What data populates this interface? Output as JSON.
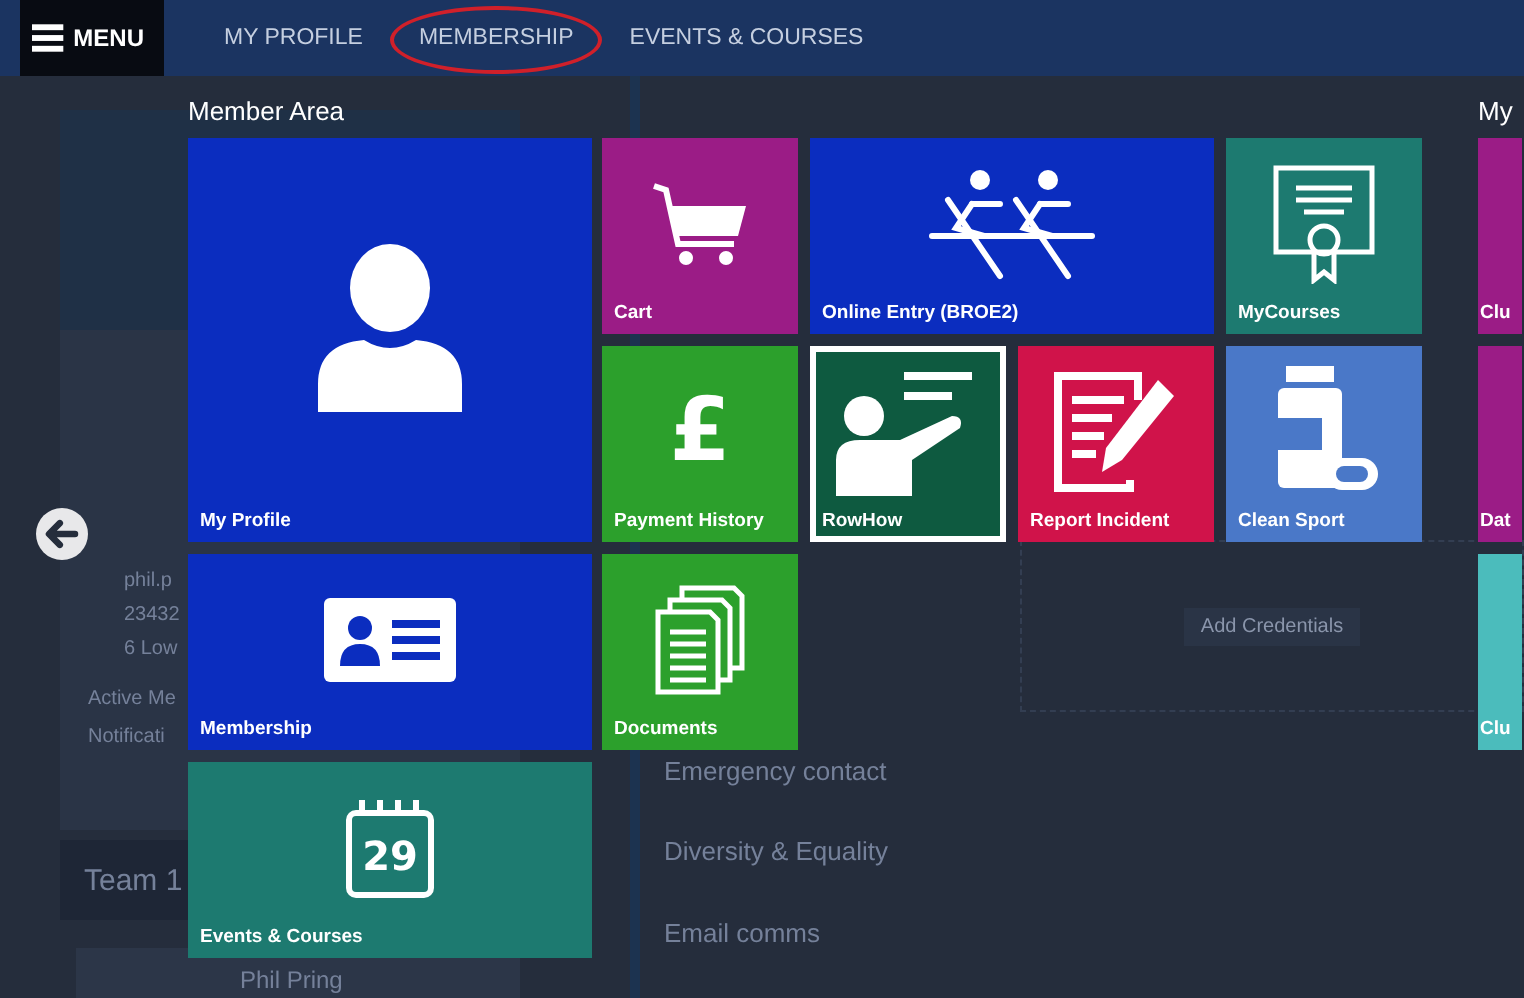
{
  "menu_button": {
    "label": "MENU"
  },
  "nav": [
    {
      "label": "MY PROFILE",
      "circled": false
    },
    {
      "label": "MEMBERSHIP",
      "circled": true
    },
    {
      "label": "EVENTS & COURSES",
      "circled": false
    }
  ],
  "background": {
    "contact_lines": [
      "phil.p",
      "23432",
      "6 Low"
    ],
    "status_lines": [
      "Active Me",
      "Notificati"
    ],
    "team_heading": "Team 1",
    "member_name": "Phil Pring",
    "settings_items": [
      "Emergency contact",
      "Diversity & Equality",
      "Email comms"
    ],
    "credentials_button": "Add Credentials"
  },
  "member_area": {
    "title": "Member Area",
    "primary_tiles": [
      {
        "label": "My Profile",
        "color": "#0b2dbf",
        "kind": "large",
        "focused": false
      },
      {
        "label": "Membership",
        "color": "#0b2dbf",
        "kind": "wide",
        "focused": false
      },
      {
        "label": "Events & Courses",
        "color": "#1d7a70",
        "kind": "wide",
        "focused": false,
        "icon_text": "29"
      }
    ],
    "tiles": [
      {
        "label": "Cart",
        "color": "#9b1c86",
        "kind": "small",
        "focused": false
      },
      {
        "label": "Online Entry (BROE2)",
        "color": "#0b2dbf",
        "kind": "wide",
        "focused": false
      },
      {
        "label": "MyCourses",
        "color": "#1d7a70",
        "kind": "small",
        "focused": false
      },
      {
        "label": "Payment History",
        "color": "#2ca02c",
        "kind": "small",
        "focused": false,
        "icon_text": "£"
      },
      {
        "label": "RowHow",
        "color": "#0e5a40",
        "kind": "small",
        "focused": true
      },
      {
        "label": "Report Incident",
        "color": "#d0134a",
        "kind": "small",
        "focused": false
      },
      {
        "label": "Clean Sport",
        "color": "#4a78c8",
        "kind": "small",
        "focused": false
      },
      {
        "label": "Documents",
        "color": "#2ca02c",
        "kind": "small",
        "focused": false
      }
    ]
  },
  "my_area": {
    "title": "My",
    "tiles": [
      {
        "label": "Clu",
        "color": "#9b1c86"
      },
      {
        "label": "Dat",
        "color": "#9b1c86"
      },
      {
        "label": "Clu",
        "color": "#4bbcbc"
      }
    ]
  }
}
